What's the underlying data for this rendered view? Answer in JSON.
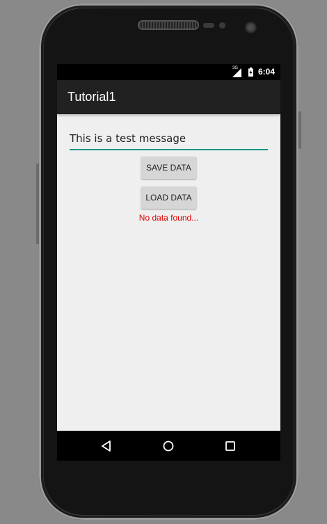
{
  "status_bar": {
    "network_label": "3G",
    "time": "6:04"
  },
  "app_bar": {
    "title": "Tutorial1"
  },
  "main": {
    "message_input_value": "This is a test message",
    "save_button_label": "SAVE DATA",
    "load_button_label": "LOAD DATA",
    "status_message": "No data found..."
  },
  "nav_bar": {
    "icons": [
      "back-icon",
      "home-icon",
      "recents-icon"
    ]
  },
  "colors": {
    "accent_underline": "#0c9688",
    "error_text": "#e00000",
    "app_bar": "#212121",
    "content_background": "#efefef"
  }
}
